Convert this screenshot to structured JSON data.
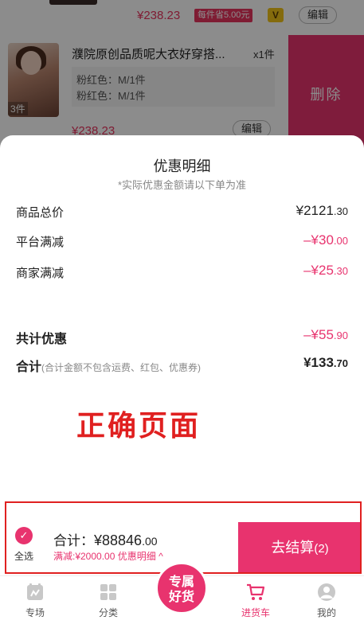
{
  "cart": {
    "top_item": {
      "price": "¥238.23",
      "badge": "每件省5.00元",
      "vip_icon": "V",
      "edit_label": "编辑"
    },
    "product": {
      "title": "濮院原创品质呢大衣好穿搭...",
      "qty": "x1件",
      "image_count": "3件",
      "sku_lines": [
        "粉红色：M/1件",
        "粉红色：M/1件"
      ],
      "price": "¥238.23",
      "edit_label": "编辑",
      "delete_label": "删除"
    }
  },
  "sheet": {
    "title": "优惠明细",
    "subtitle": "*实际优惠金额请以下单为准",
    "rows": [
      {
        "label": "商品总价",
        "value_int": "¥2121",
        "value_dec": ".30"
      },
      {
        "label": "平台满减",
        "value_int": "–¥30",
        "value_dec": ".00"
      },
      {
        "label": "商家满减",
        "value_int": "–¥25",
        "value_dec": ".30"
      }
    ],
    "total_discount": {
      "label": "共计优惠",
      "value_int": "–¥55",
      "value_dec": ".90"
    },
    "sum": {
      "label": "合计",
      "note": "(合计金额不包含运费、红包、优惠券)",
      "value_int": "¥133",
      "value_dec": ".70"
    },
    "watermark": "正确页面"
  },
  "checkout": {
    "check_icon": "✓",
    "select_all": "全选",
    "total_prefix": "合计：",
    "total_int": "¥88846",
    "total_dec": ".00",
    "discount_text": "满减:¥2000.00",
    "detail_link": "优惠明细 ^",
    "pay_label": "去结算",
    "pay_count": "(2)"
  },
  "nav": {
    "items": [
      {
        "label": "专场",
        "icon": "special-icon"
      },
      {
        "label": "分类",
        "icon": "grid-icon"
      },
      {
        "label": "进货车",
        "icon": "cart-icon"
      },
      {
        "label": "我的",
        "icon": "user-icon"
      }
    ],
    "center_line1": "专属",
    "center_line2": "好货"
  },
  "colors": {
    "accent": "#e8336e",
    "highlight_outline": "#e02020"
  }
}
